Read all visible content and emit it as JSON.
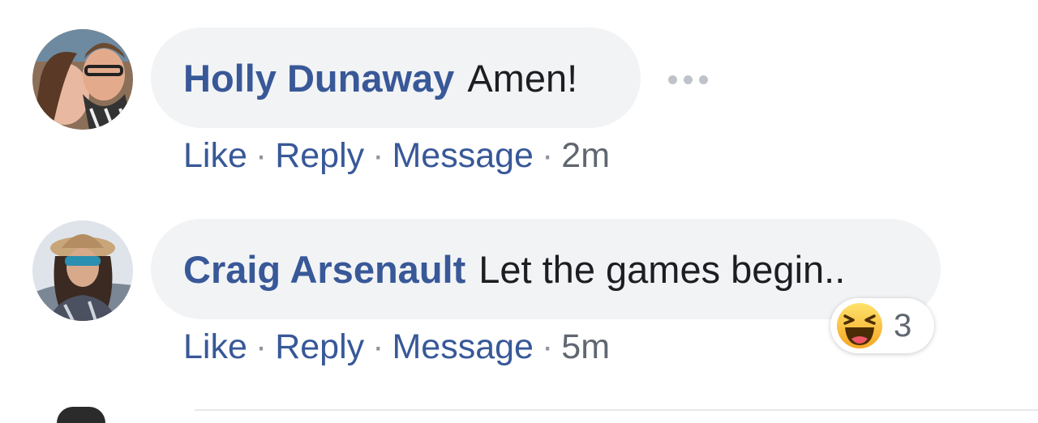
{
  "comments": [
    {
      "author": "Holly Dunaway",
      "text": "Amen!",
      "actions": {
        "like": "Like",
        "reply": "Reply",
        "message": "Message"
      },
      "time": "2m"
    },
    {
      "author": "Craig Arsenault",
      "text": "Let the games begin..",
      "actions": {
        "like": "Like",
        "reply": "Reply",
        "message": "Message"
      },
      "time": "5m",
      "reactions": {
        "icon": "haha-emoji-icon",
        "count": "3"
      }
    }
  ],
  "separator": "·",
  "colors": {
    "author": "#385898",
    "link": "#385898",
    "bubble": "#f2f3f5",
    "text": "#1c1e21",
    "meta": "#606770"
  }
}
